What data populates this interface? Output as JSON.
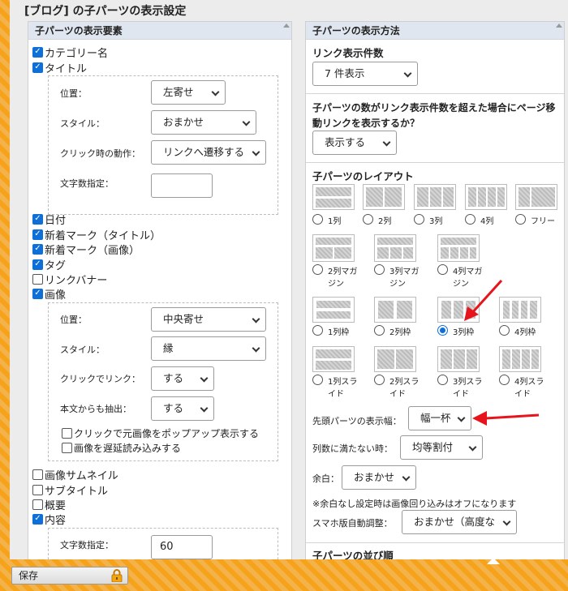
{
  "page_title": "[ブログ] の子パーツの表示設定",
  "left": {
    "header": "子パーツの表示要素",
    "checkboxes_top": [
      {
        "label": "カテゴリー名",
        "checked": true
      },
      {
        "label": "タイトル",
        "checked": true
      }
    ],
    "title_box": {
      "position_label": "位置：",
      "position_value": "左寄せ",
      "style_label": "スタイル：",
      "style_value": "おまかせ",
      "click_label": "クリック時の動作：",
      "click_value": "リンクへ遷移する",
      "chars_label": "文字数指定：",
      "chars_value": ""
    },
    "checkboxes_mid": [
      {
        "label": "日付",
        "checked": true
      },
      {
        "label": "新着マーク（タイトル）",
        "checked": true
      },
      {
        "label": "新着マーク（画像）",
        "checked": true
      },
      {
        "label": "タグ",
        "checked": true
      },
      {
        "label": "リンクバナー",
        "checked": false
      },
      {
        "label": "画像",
        "checked": true
      }
    ],
    "image_box": {
      "position_label": "位置：",
      "position_value": "中央寄せ",
      "style_label": "スタイル：",
      "style_value": "縁",
      "click_label": "クリックでリンク：",
      "click_value": "する",
      "extract_label": "本文からも抽出：",
      "extract_value": "する",
      "popup_label": "クリックで元画像をポップアップ表示する",
      "popup_checked": false,
      "lazy_label": "画像を遅延読み込みする",
      "lazy_checked": false
    },
    "checkboxes_bottom": [
      {
        "label": "画像サムネイル",
        "checked": false
      },
      {
        "label": "サブタイトル",
        "checked": false
      },
      {
        "label": "概要",
        "checked": false
      },
      {
        "label": "内容",
        "checked": true
      }
    ],
    "content_box": {
      "chars_label": "文字数指定：",
      "chars_value": "60"
    }
  },
  "right": {
    "header": "子パーツの表示方法",
    "link_count_title": "リンク表示件数",
    "link_count_value": "7 件表示",
    "overflow_question": "子パーツの数がリンク表示件数を超えた場合にページ移動リンクを表示するか？",
    "overflow_line1": "子パーツの数がリンク表示件数を超えた場合にページ移",
    "overflow_line2": "動リンクを表示するか？",
    "overflow_value": "表示する",
    "layout_title": "子パーツのレイアウト",
    "layouts_row1": [
      "1列",
      "2列",
      "3列",
      "4列",
      "フリー"
    ],
    "layouts_row2": [
      "2列マガジン",
      "3列マガジン",
      "4列マガジン"
    ],
    "layouts_row2_l1": [
      "2列マガ",
      "3列マガ",
      "4列マガ"
    ],
    "layouts_row2_l2": [
      "ジン",
      "ジン",
      "ジン"
    ],
    "layouts_row3": [
      "1列枠",
      "2列枠",
      "3列枠",
      "4列枠"
    ],
    "layouts_row4_l1": [
      "1列スラ",
      "2列スラ",
      "3列スラ",
      "4列スラ"
    ],
    "layouts_row4_l2": [
      "イド",
      "イド",
      "イド",
      "イド"
    ],
    "selected_layout": "3列枠",
    "head_width_label": "先頭パーツの表示幅：",
    "head_width_value": "幅一杯",
    "shortage_label": "列数に満たない時：",
    "shortage_value": "均等割付",
    "margin_label": "余白：",
    "margin_value": "おまかせ",
    "margin_note": "※余白なし設定時は画像回り込みはオフになります",
    "sp_label": "スマホ版自動調整：",
    "sp_value": "おまかせ（高度な",
    "order_title": "子パーツの並び順"
  },
  "footer": {
    "save_label": "保存"
  },
  "colors": {
    "accent": "#0f6fd8",
    "arrow": "#e8141c",
    "background": "#f7a21b"
  }
}
